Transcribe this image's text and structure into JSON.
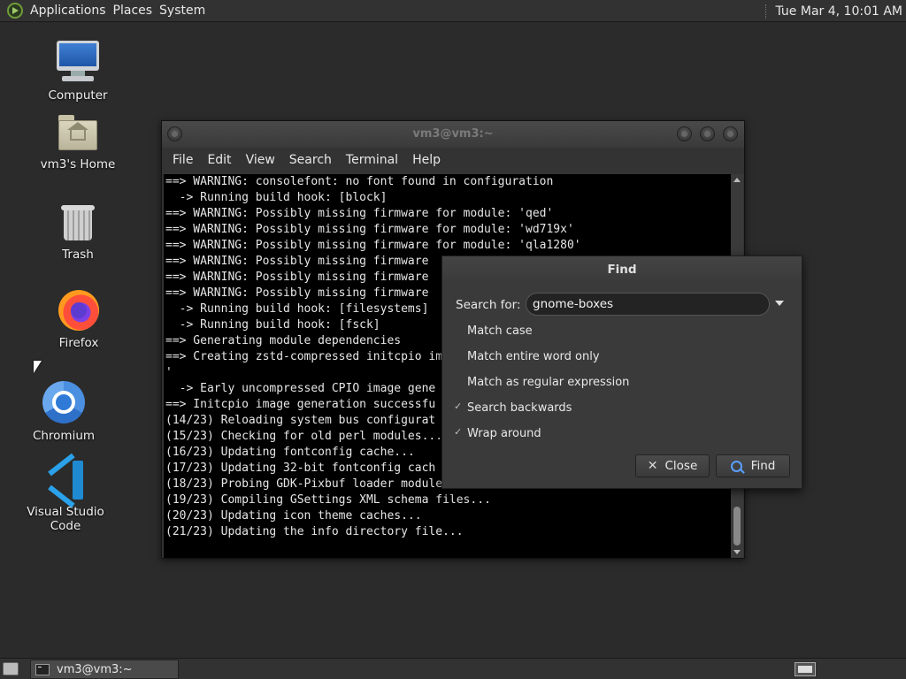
{
  "top_panel": {
    "menus": [
      "Applications",
      "Places",
      "System"
    ],
    "clock": "Tue Mar  4, 10:01 AM"
  },
  "desktop_icons": {
    "computer": "Computer",
    "home": "vm3's Home",
    "trash": "Trash",
    "firefox": "Firefox",
    "chromium": "Chromium",
    "vscode": "Visual Studio Code"
  },
  "terminal": {
    "title": "vm3@vm3:~",
    "menus": [
      "File",
      "Edit",
      "View",
      "Search",
      "Terminal",
      "Help"
    ],
    "lines": [
      "==> WARNING: consolefont: no font found in configuration",
      "  -> Running build hook: [block]",
      "==> WARNING: Possibly missing firmware for module: 'qed'",
      "==> WARNING: Possibly missing firmware for module: 'wd719x'",
      "==> WARNING: Possibly missing firmware for module: 'qla1280'",
      "==> WARNING: Possibly missing firmware",
      "==> WARNING: Possibly missing firmware",
      "==> WARNING: Possibly missing firmware",
      "  -> Running build hook: [filesystems]",
      "  -> Running build hook: [fsck]",
      "==> Generating module dependencies",
      "==> Creating zstd-compressed initcpio im",
      "'",
      "  -> Early uncompressed CPIO image gene",
      "==> Initcpio image generation successfu",
      "(14/23) Reloading system bus configurat",
      "(15/23) Checking for old perl modules...",
      "(16/23) Updating fontconfig cache...",
      "(17/23) Updating 32-bit fontconfig cach",
      "(18/23) Probing GDK-Pixbuf loader module",
      "(19/23) Compiling GSettings XML schema files...",
      "(20/23) Updating icon theme caches...",
      "(21/23) Updating the info directory file..."
    ]
  },
  "find_dialog": {
    "title": "Find",
    "search_label": "Search for:",
    "search_value": "gnome-boxes",
    "options": [
      {
        "label": "Match case",
        "checked": false
      },
      {
        "label": "Match entire word only",
        "checked": false
      },
      {
        "label": "Match as regular expression",
        "checked": false
      },
      {
        "label": "Search backwards",
        "checked": true
      },
      {
        "label": "Wrap around",
        "checked": true
      }
    ],
    "close_label": "Close",
    "find_label": "Find"
  },
  "taskbar": {
    "window_label": "vm3@vm3:~"
  },
  "icons": {
    "distro": "distro-logo-icon",
    "close": "close-x-icon",
    "find": "magnifier-icon"
  }
}
